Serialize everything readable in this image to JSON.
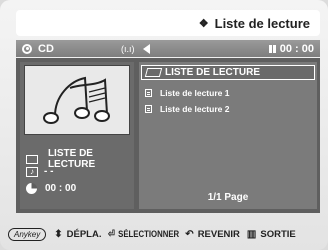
{
  "header": {
    "title": "Liste de lecture",
    "title_icon": "diamond-icon"
  },
  "status": {
    "disc_label": "CD",
    "mid_text": "(ı.ı)",
    "time": "00 : 00"
  },
  "left_panel": {
    "thumbnail": "music-notes",
    "folder_label": "LISTE DE LECTURE",
    "track_label": "- -",
    "time_label": "00 : 00"
  },
  "right_panel": {
    "selected_folder": "LISTE DE LECTURE",
    "items": [
      "Liste de lecture 1",
      "Liste de lecture 2"
    ],
    "page": "1/1 Page"
  },
  "footer": {
    "anykey": "Anykey",
    "move": "DÉPLA.",
    "select": "SÉLECTIONNER",
    "back": "REVENIR",
    "exit": "SORTIE"
  }
}
